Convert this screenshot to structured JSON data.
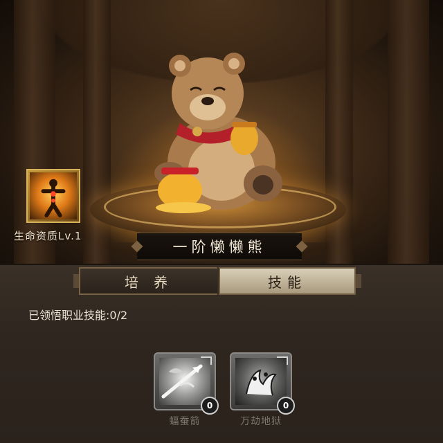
{
  "pet": {
    "name": "一阶懒懒熊",
    "aptitude_label": "生命资质Lv.1",
    "aptitude_icon": "body-aura-icon",
    "portrait_icon": "bear-with-honey-icon"
  },
  "tabs": [
    {
      "label": "培 养",
      "active": false
    },
    {
      "label": "技能",
      "active": true
    }
  ],
  "skills_panel": {
    "comprehended_text": "已领悟职业技能:0/2",
    "skills": [
      {
        "name": "蝠蚕箭",
        "level": "0",
        "icon": "bat-arrow-icon"
      },
      {
        "name": "万劫地狱",
        "level": "0",
        "icon": "hell-claw-icon"
      }
    ]
  },
  "colors": {
    "accent_gold": "#d9b35c",
    "panel_bg": "#2e261f",
    "active_tab": "#d9cfb8"
  }
}
